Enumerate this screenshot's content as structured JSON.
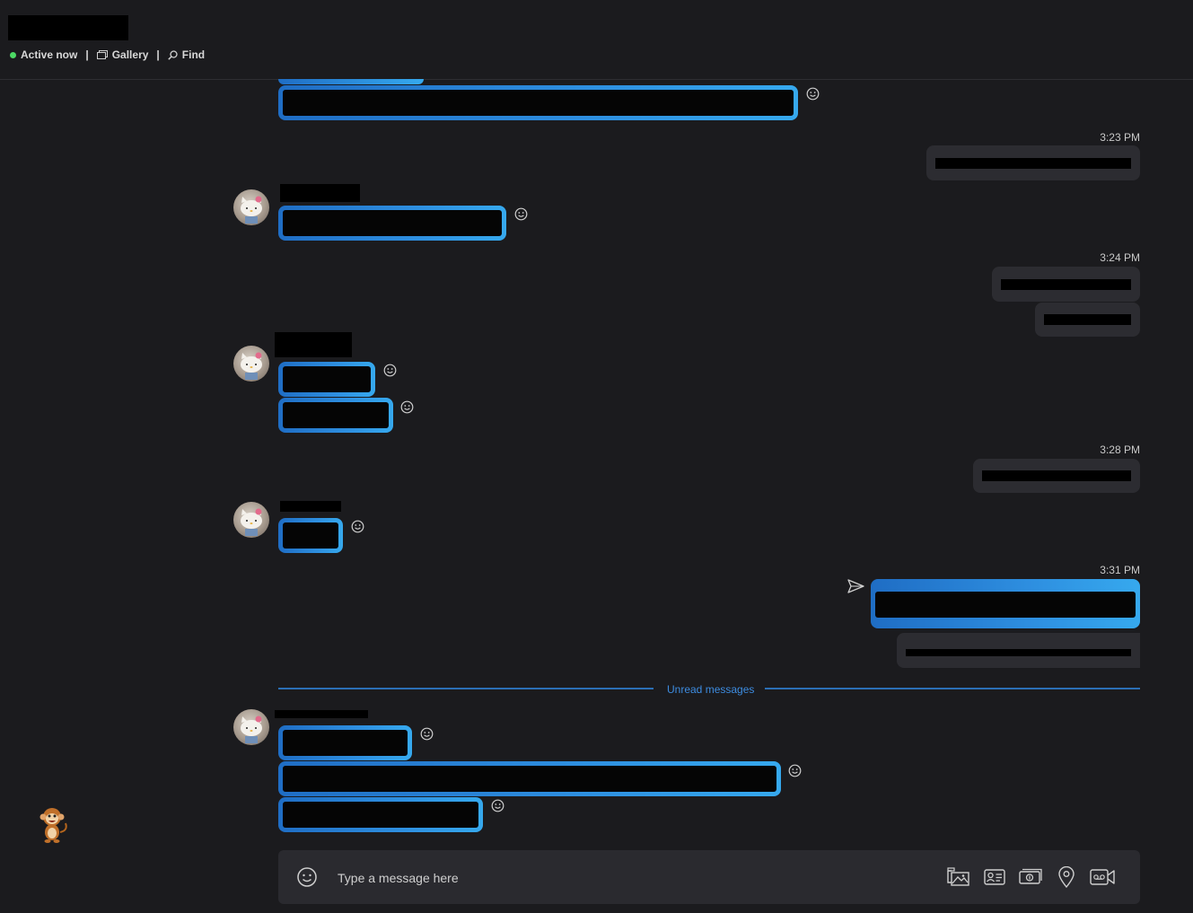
{
  "header": {
    "status_label": "Active now",
    "gallery_label": "Gallery",
    "find_label": "Find",
    "separator": "|"
  },
  "timestamps": [
    "3:23 PM",
    "3:24 PM",
    "3:28 PM",
    "3:31 PM"
  ],
  "unread_label": "Unread messages",
  "composer": {
    "placeholder": "Type a message here"
  },
  "icons": {
    "emoji": "emoji-icon",
    "gallery": "gallery-icon",
    "find": "search-icon",
    "sent": "sent-icon",
    "send_image": "image-icon",
    "contact": "contact-card-icon",
    "money": "money-icon",
    "location": "location-pin-icon",
    "video_message": "video-message-icon",
    "mascot": "monkey-icon"
  },
  "colors": {
    "background": "#1b1b1e",
    "incoming_gradient_start": "#1f6dc4",
    "incoming_gradient_end": "#36a9ee",
    "outgoing_bubble": "#2c2c31",
    "unread_divider": "#2b6fb5",
    "online_dot": "#4cd964"
  }
}
